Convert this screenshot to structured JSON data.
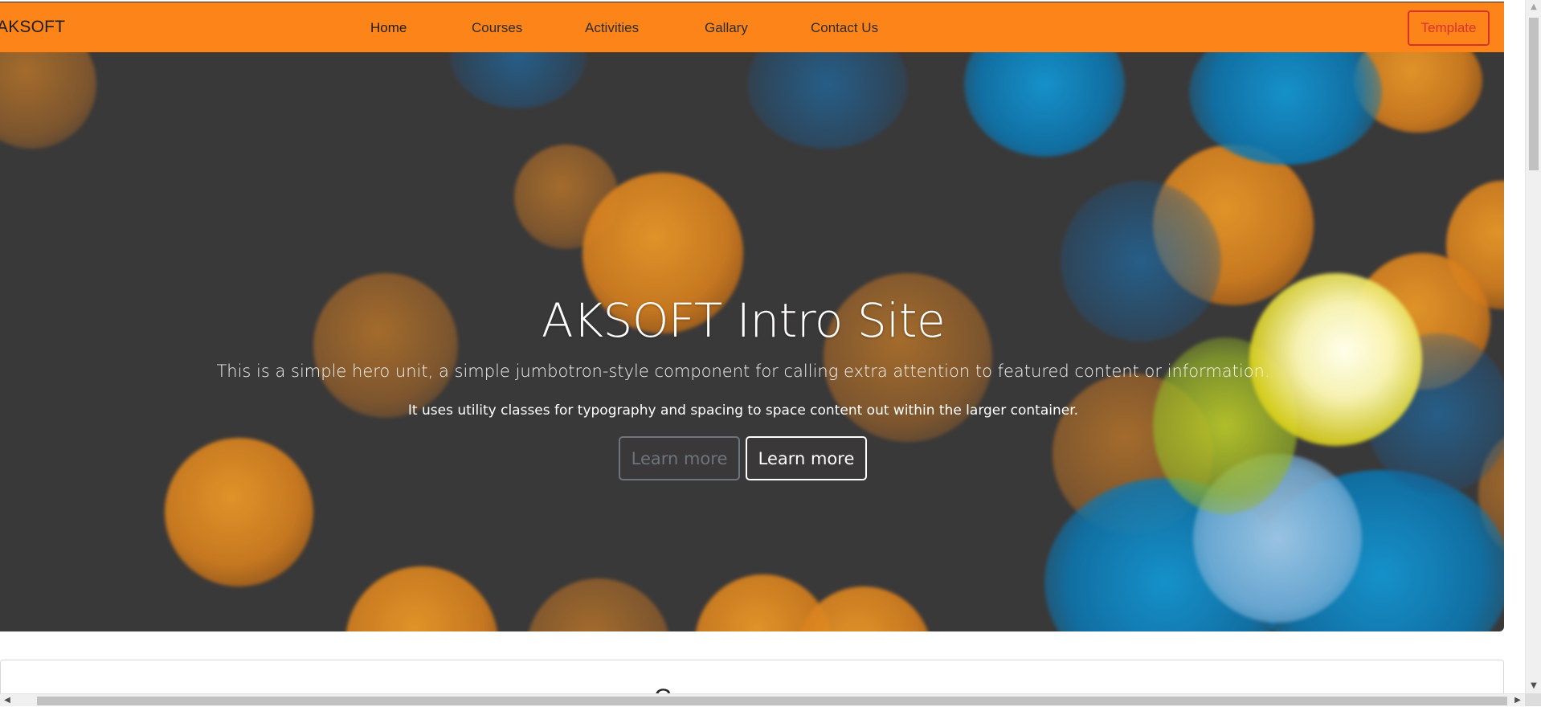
{
  "navbar": {
    "brand": "AKSOFT",
    "links": [
      "Home",
      "Courses",
      "Activities",
      "Gallary",
      "Contact Us"
    ],
    "template_button": "Template",
    "background_color": "#fd8419",
    "template_color": "#d9322c"
  },
  "hero": {
    "title": "AKSOFT Intro Site",
    "lead": "This is a simple hero unit, a simple jumbotron-style component for calling extra attention to featured content or information.",
    "subtext": "It uses utility classes for typography and spacing to space content out within the larger container.",
    "buttons": {
      "secondary": "Learn more",
      "primary": "Learn more"
    }
  },
  "next_section": {
    "heading_partial": "C"
  },
  "scrollbars": {
    "vertical": {
      "up_icon": "arrow-up-icon",
      "down_icon": "arrow-down-icon"
    },
    "horizontal": {
      "left_icon": "arrow-left-icon",
      "right_icon": "arrow-right-icon"
    }
  }
}
